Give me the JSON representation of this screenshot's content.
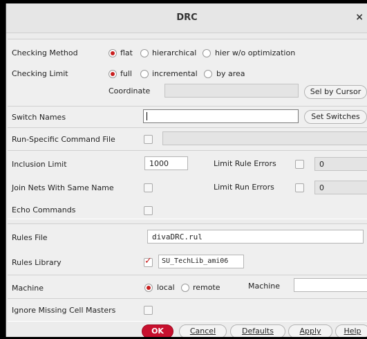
{
  "window": {
    "title": "DRC",
    "close_glyph": "×"
  },
  "checking_method": {
    "label": "Checking Method",
    "options": [
      "flat",
      "hierarchical",
      "hier w/o optimization"
    ],
    "selected": "flat"
  },
  "checking_limit": {
    "label": "Checking Limit",
    "options": [
      "full",
      "incremental",
      "by area"
    ],
    "selected": "full",
    "coordinate_label": "Coordinate",
    "coordinate_value": "",
    "sel_by_cursor": "Sel by Cursor"
  },
  "switch_names": {
    "label": "Switch Names",
    "value": "",
    "button": "Set Switches"
  },
  "run_specific": {
    "label": "Run-Specific Command File",
    "checked": false,
    "value": ""
  },
  "inclusion_limit": {
    "label": "Inclusion Limit",
    "value": "1000"
  },
  "limit_rule_errors": {
    "label": "Limit Rule Errors",
    "checked": false,
    "value": "0"
  },
  "join_nets": {
    "label": "Join Nets With Same Name",
    "checked": false
  },
  "limit_run_errors": {
    "label": "Limit Run Errors",
    "checked": false,
    "value": "0"
  },
  "echo_commands": {
    "label": "Echo Commands",
    "checked": false
  },
  "rules_file": {
    "label": "Rules File",
    "value": "divaDRC.rul"
  },
  "rules_library": {
    "label": "Rules Library",
    "checked": true,
    "value": "SU_TechLib_ami06"
  },
  "machine": {
    "label": "Machine",
    "options": [
      "local",
      "remote"
    ],
    "selected": "local",
    "machine_label": "Machine",
    "machine_value": ""
  },
  "ignore_missing": {
    "label": "Ignore Missing Cell Masters",
    "checked": false
  },
  "buttons": {
    "ok": "OK",
    "cancel": "Cancel",
    "defaults": "Defaults",
    "apply": "Apply",
    "help": "Help"
  },
  "colors": {
    "accent": "#c8102e",
    "radio_dot": "#c81e1e"
  }
}
